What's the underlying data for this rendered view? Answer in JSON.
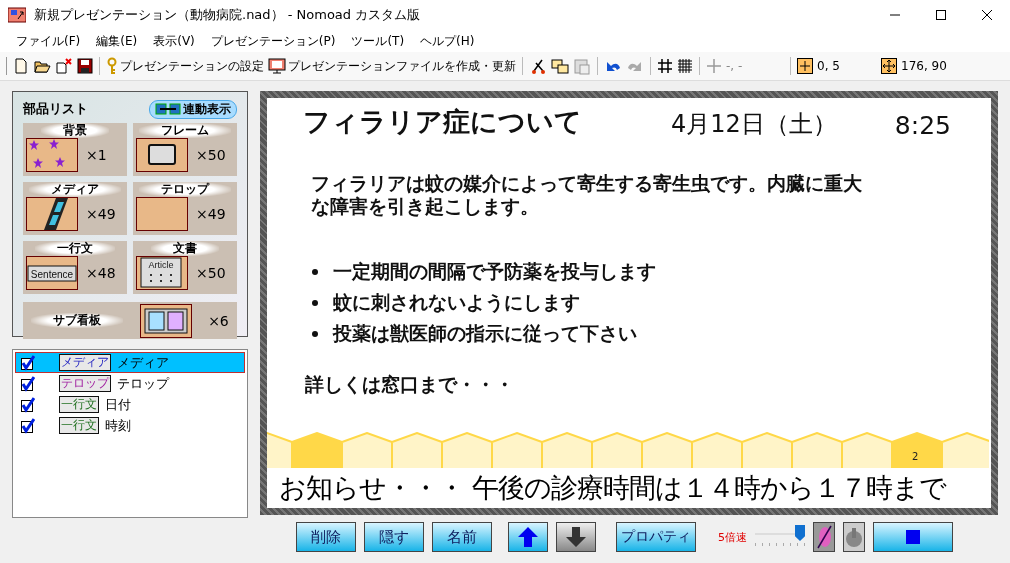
{
  "window": {
    "title": "新規プレゼンテーション（動物病院.nad） - Nomoad カスタム版"
  },
  "menu": [
    "ファイル(F)",
    "編集(E)",
    "表示(V)",
    "プレゼンテーション(P)",
    "ツール(T)",
    "ヘルプ(H)"
  ],
  "toolbar": {
    "settings_label": "プレゼンテーションの設定",
    "build_label": "プレゼンテーションファイルを作成・更新",
    "cursor_position": "-, -",
    "grid_value": "0, 5",
    "size_value": "176, 90"
  },
  "parts_panel": {
    "title": "部品リスト",
    "link_button": "連動表示",
    "parts": [
      {
        "label": "背景",
        "count": "×1",
        "kind": "stars"
      },
      {
        "label": "フレーム",
        "count": "×50",
        "kind": "frame"
      },
      {
        "label": "メディア",
        "count": "×49",
        "kind": "film"
      },
      {
        "label": "テロップ",
        "count": "×49",
        "kind": "blank"
      },
      {
        "label": "一行文",
        "count": "×48",
        "kind": "sentence",
        "thumb_text": "Sentence"
      },
      {
        "label": "文書",
        "count": "×50",
        "kind": "article",
        "thumb_text": "Article"
      },
      {
        "label": "サブ看板",
        "count": "×6",
        "kind": "sub"
      }
    ]
  },
  "layers": [
    {
      "tag": "メディア",
      "name": "メディア",
      "checked": true,
      "selected": true,
      "kind": "media"
    },
    {
      "tag": "テロップ",
      "name": "テロップ",
      "checked": true,
      "selected": false,
      "kind": "telop"
    },
    {
      "tag": "一行文",
      "name": "日付",
      "checked": true,
      "selected": false,
      "kind": "line"
    },
    {
      "tag": "一行文",
      "name": "時刻",
      "checked": true,
      "selected": false,
      "kind": "line"
    }
  ],
  "slide": {
    "title": "フィラリア症について",
    "date": "4月12日（土）",
    "time": "8:25",
    "body": "フィラリアは蚊の媒介によって寄生する寄生虫です。内臓に重大な障害を引き起こします。",
    "bullets": [
      "一定期間の間隔で予防薬を投与します",
      "蚊に刺されないようにします",
      "投薬は獣医師の指示に従って下さい"
    ],
    "footer": "詳しくは窓口まで・・・",
    "page_number": "2",
    "ticker": "お知らせ・・・ 午後の診療時間は１４時から１７時まで"
  },
  "controls": {
    "buttons": [
      "削除",
      "隠す",
      "名前"
    ],
    "property_button": "プロパティ",
    "speed_label": "5倍速",
    "speed": {
      "level": 1.0
    }
  }
}
